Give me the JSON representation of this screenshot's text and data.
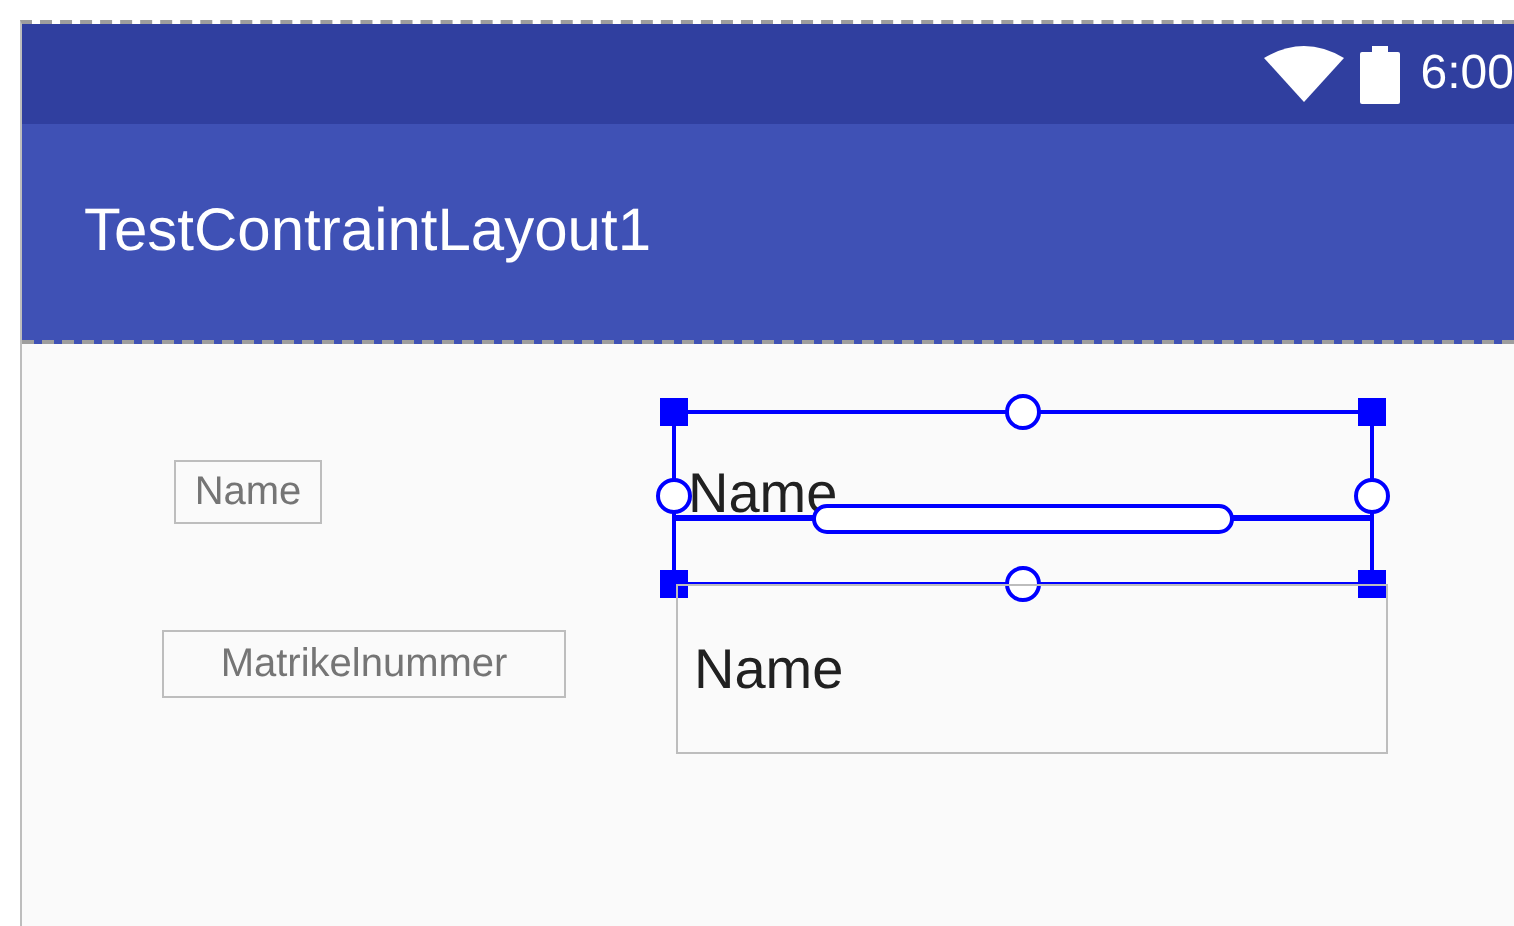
{
  "status_bar": {
    "time": "6:00"
  },
  "app_bar": {
    "title": "TestContraintLayout1"
  },
  "labels": [
    {
      "text": "Name"
    },
    {
      "text": "Matrikelnummer"
    }
  ],
  "fields": [
    {
      "value": "Name",
      "selected": true
    },
    {
      "value": "Name",
      "selected": false
    }
  ]
}
